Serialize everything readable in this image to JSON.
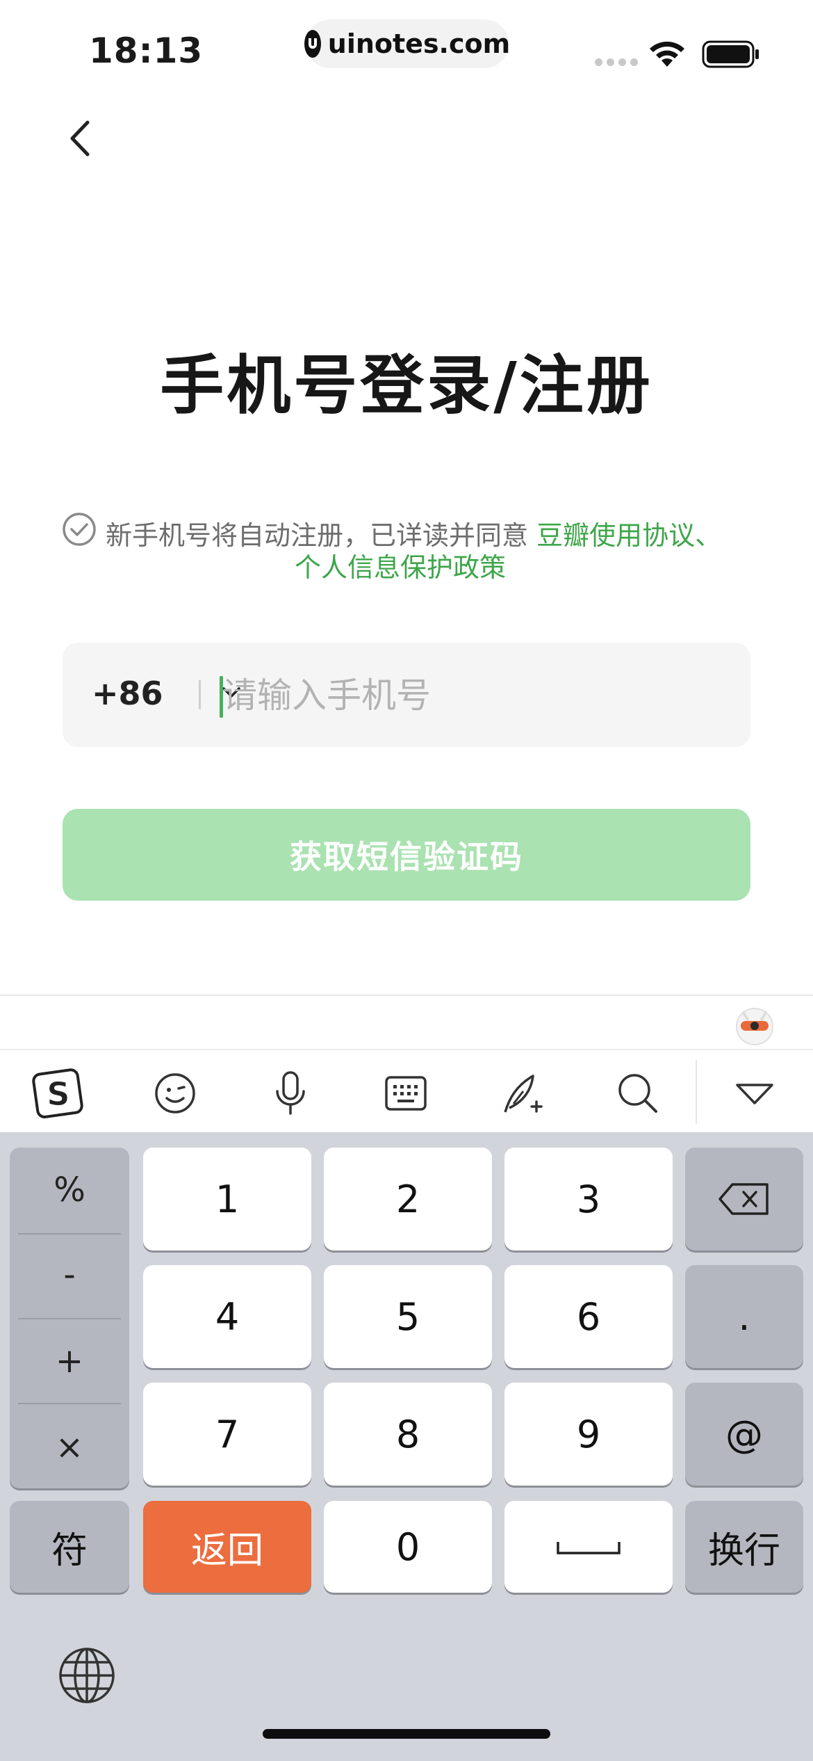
{
  "status_bar": {
    "time": "18:13",
    "url": "uinotes.com"
  },
  "page": {
    "title": "手机号登录/注册"
  },
  "agreement": {
    "text": "新手机号将自动注册，已详读并同意",
    "link1": "豆瓣使用协议、",
    "link2": "个人信息保护政策"
  },
  "phone": {
    "country_code": "+86",
    "placeholder": "请输入手机号",
    "value": ""
  },
  "sms_button": {
    "label": "获取短信验证码",
    "color": "#aae2b1"
  },
  "keyboard": {
    "symbols": [
      "%",
      "-",
      "+",
      "×"
    ],
    "digits": [
      "1",
      "2",
      "3",
      "4",
      "5",
      "6",
      "7",
      "8",
      "9"
    ],
    "dot": ".",
    "at": "@",
    "fu": "符",
    "back": "返回",
    "zero": "0",
    "enter": "换行",
    "toolbar_icons": [
      "sogou-logo-icon",
      "emoji-icon",
      "microphone-icon",
      "keyboard-icon",
      "handwriting-icon",
      "search-icon",
      "collapse-keyboard-icon"
    ]
  },
  "colors": {
    "accent_green": "#3ea64a",
    "back_key": "#ec6d3e"
  }
}
